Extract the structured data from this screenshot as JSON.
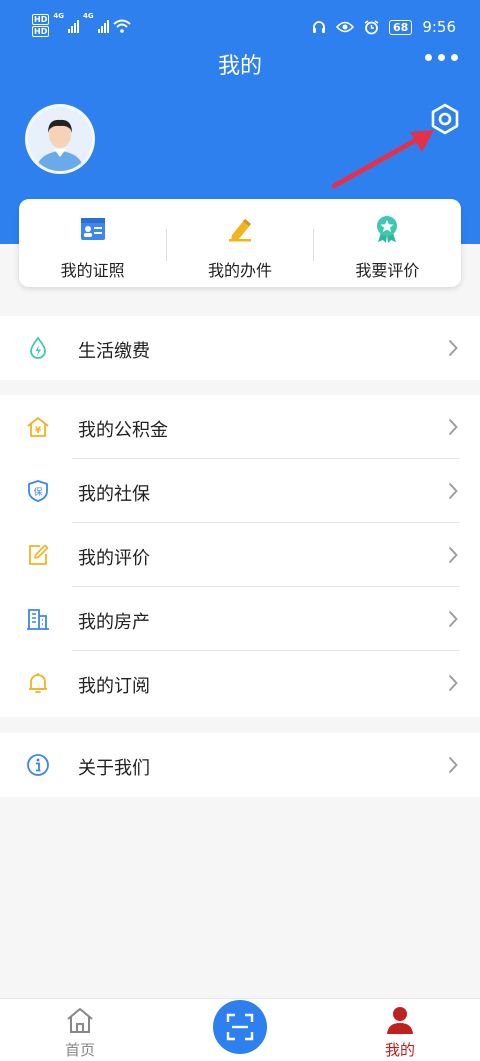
{
  "status_bar": {
    "badge_1": "HD",
    "badge_2": "HD",
    "net_1": "4G",
    "net_2": "4G",
    "battery": "68",
    "time": "9:56"
  },
  "header": {
    "title": "我的"
  },
  "quick_actions": [
    {
      "label": "我的证照",
      "icon": "id-card-icon"
    },
    {
      "label": "我的办件",
      "icon": "pencil-icon"
    },
    {
      "label": "我要评价",
      "icon": "award-star-icon"
    }
  ],
  "menu_sections": [
    [
      {
        "label": "生活缴费",
        "icon": "water-energy-icon"
      }
    ],
    [
      {
        "label": "我的公积金",
        "icon": "house-yuan-icon"
      },
      {
        "label": "我的社保",
        "icon": "shield-insurance-icon"
      },
      {
        "label": "我的评价",
        "icon": "edit-note-icon"
      },
      {
        "label": "我的房产",
        "icon": "building-icon"
      },
      {
        "label": "我的订阅",
        "icon": "bell-icon"
      }
    ],
    [
      {
        "label": "关于我们",
        "icon": "info-icon"
      }
    ]
  ],
  "icon_glyphs": {
    "yuan": "¥",
    "insurance": "保"
  },
  "tab_bar": {
    "home_label": "首页",
    "mine_label": "我的",
    "active_color": "#c0201e",
    "inactive_color": "#888888"
  },
  "colors": {
    "primary": "#2f80ef",
    "teal": "#3cc9b0",
    "yellow": "#f2b321",
    "red_arrow": "#e5304a"
  }
}
